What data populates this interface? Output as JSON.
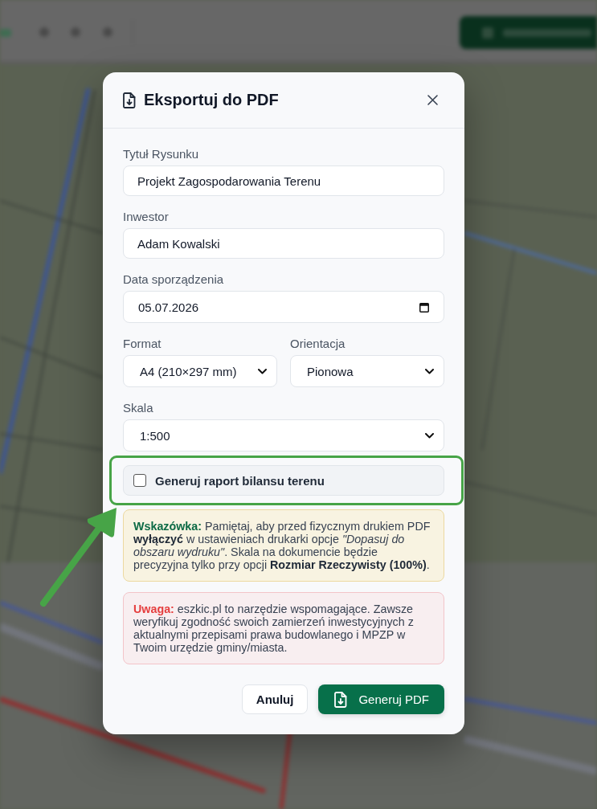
{
  "dialog": {
    "title": "Eksportuj do PDF",
    "rows": [
      {
        "fields": [
          {
            "kind": "text",
            "label": "Tytuł Rysunku",
            "value": "Projekt Zagospodarowania Terenu"
          }
        ]
      },
      {
        "fields": [
          {
            "kind": "text",
            "label": "Inwestor",
            "value": "Adam Kowalski"
          }
        ]
      },
      {
        "fields": [
          {
            "kind": "date",
            "label": "Data sporządzenia",
            "value": "05.07.2026"
          }
        ]
      },
      {
        "fields": [
          {
            "kind": "select",
            "label": "Format",
            "value": "A4 (210×297 mm)"
          },
          {
            "kind": "select",
            "label": "Orientacja",
            "value": "Pionowa"
          }
        ]
      },
      {
        "fields": [
          {
            "kind": "select",
            "label": "Skala",
            "value": "1:500"
          }
        ]
      }
    ],
    "option": {
      "label": "Generuj raport bilansu terenu",
      "checked": false
    },
    "notes": [
      {
        "kind": "tip",
        "label": "Wskazówka:",
        "text": "Pamiętaj, aby przed fizycznym drukiem PDF **wyłączyć** w ustawieniach drukarki opcje *\"Dopasuj do obszaru wydruku\"*. Skala na dokumencie będzie precyzyjna tylko przy opcji **Rozmiar Rzeczywisty (100%)**."
      },
      {
        "kind": "warning",
        "label": "Uwaga:",
        "text": "eszkic.pl to narzędzie wspomagające. Zawsze weryfikuj zgodność swoich zamierzeń inwestycyjnych z aktualnymi przepisami prawa budowlanego i MPZP w Twoim urzędzie gminy/miasta."
      }
    ],
    "buttons": [
      {
        "kind": "cancel",
        "label": "Anuluj"
      },
      {
        "kind": "submit",
        "label": "Generuj PDF"
      }
    ]
  },
  "annotations": {
    "highlight_frame": true,
    "pointer_arrow": true
  }
}
